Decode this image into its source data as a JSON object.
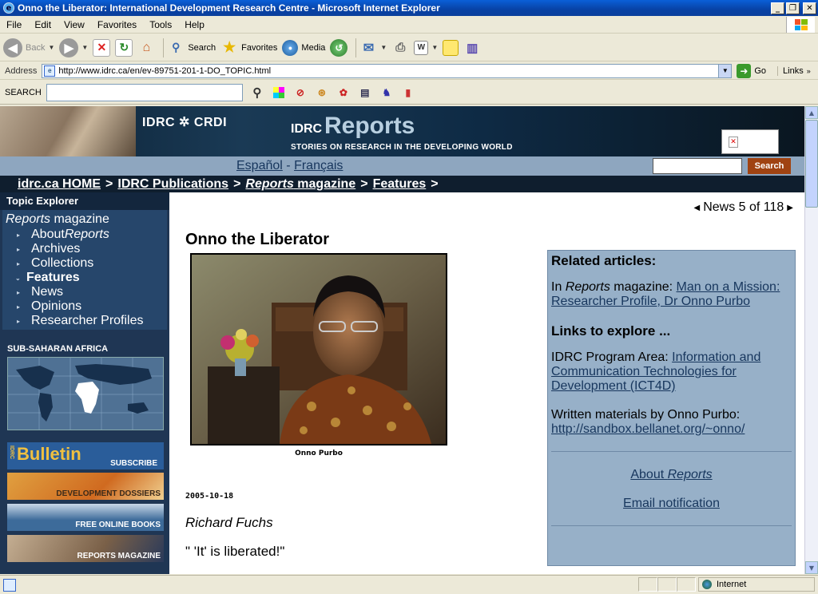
{
  "window": {
    "title": "Onno the Liberator: International Development Research Centre - Microsoft Internet Explorer",
    "min": "_",
    "max": "❐",
    "close": "✕"
  },
  "menu": [
    "File",
    "Edit",
    "View",
    "Favorites",
    "Tools",
    "Help"
  ],
  "toolbar": {
    "back": "Back",
    "search": "Search",
    "favorites": "Favorites",
    "media": "Media"
  },
  "address": {
    "label": "Address",
    "url": "http://www.idrc.ca/en/ev-89751-201-1-DO_TOPIC.html",
    "go": "Go",
    "links": "Links"
  },
  "searchbar": {
    "label": "SEARCH",
    "value": ""
  },
  "banner": {
    "org": "IDRC ✲ CRDI",
    "reports_prefix": "IDRC",
    "reports_word": "Reports",
    "tagline": "STORIES ON RESEARCH IN THE DEVELOPING WORLD"
  },
  "lang": {
    "es": "Español",
    "dash": "-",
    "fr": "Français",
    "search_button": "Search",
    "search_value": ""
  },
  "breadcrumb": [
    {
      "label": "idrc.ca HOME"
    },
    {
      "label": "IDRC Publications"
    },
    {
      "label_em": "Reports",
      "label_rest": " magazine"
    },
    {
      "label": "Features"
    }
  ],
  "leftnav": {
    "header": "Topic Explorer",
    "section_em": "Reports",
    "section_rest": " magazine",
    "items": [
      {
        "label": "About ",
        "label_em": "Reports"
      },
      {
        "label": "Archives"
      },
      {
        "label": "Collections"
      },
      {
        "label": "Features",
        "active": true
      },
      {
        "label": "News"
      },
      {
        "label": "Opinions"
      },
      {
        "label": "Researcher Profiles"
      }
    ],
    "region": "SUB-SAHARAN AFRICA",
    "promos": [
      {
        "big": "Bulletin",
        "small": "SUBSCRIBE",
        "bg": "#2a5d9a"
      },
      {
        "small": "DEVELOPMENT DOSSIERS",
        "bg": "#d9782a"
      },
      {
        "small": "FREE ONLINE BOOKS",
        "bg": "#3d6b9a"
      },
      {
        "small": "REPORTS MAGAZINE",
        "bg": "#7a6048"
      }
    ]
  },
  "article": {
    "pager": "News 5 of 118",
    "title": "Onno the Liberator",
    "caption": "Onno Purbo",
    "date": "2005-10-18",
    "author": "Richard Fuchs",
    "quote": "\" 'It' is liberated!\""
  },
  "related": {
    "heading": "Related articles:",
    "item1_prefix": "In ",
    "item1_em": "Reports",
    "item1_mid": " magazine: ",
    "item1_link": "Man on a Mission: Researcher Profile, Dr Onno Purbo",
    "links_heading": "Links to explore ...",
    "program_prefix": "IDRC Program Area: ",
    "program_link": "Information and Communication Technologies for Development (ICT4D)",
    "written_prefix": "Written materials by Onno Purbo: ",
    "written_link": "http://sandbox.bellanet.org/~onno/",
    "about_prefix": "About ",
    "about_em": "Reports",
    "email": "Email notification"
  },
  "status": {
    "zone": "Internet"
  }
}
